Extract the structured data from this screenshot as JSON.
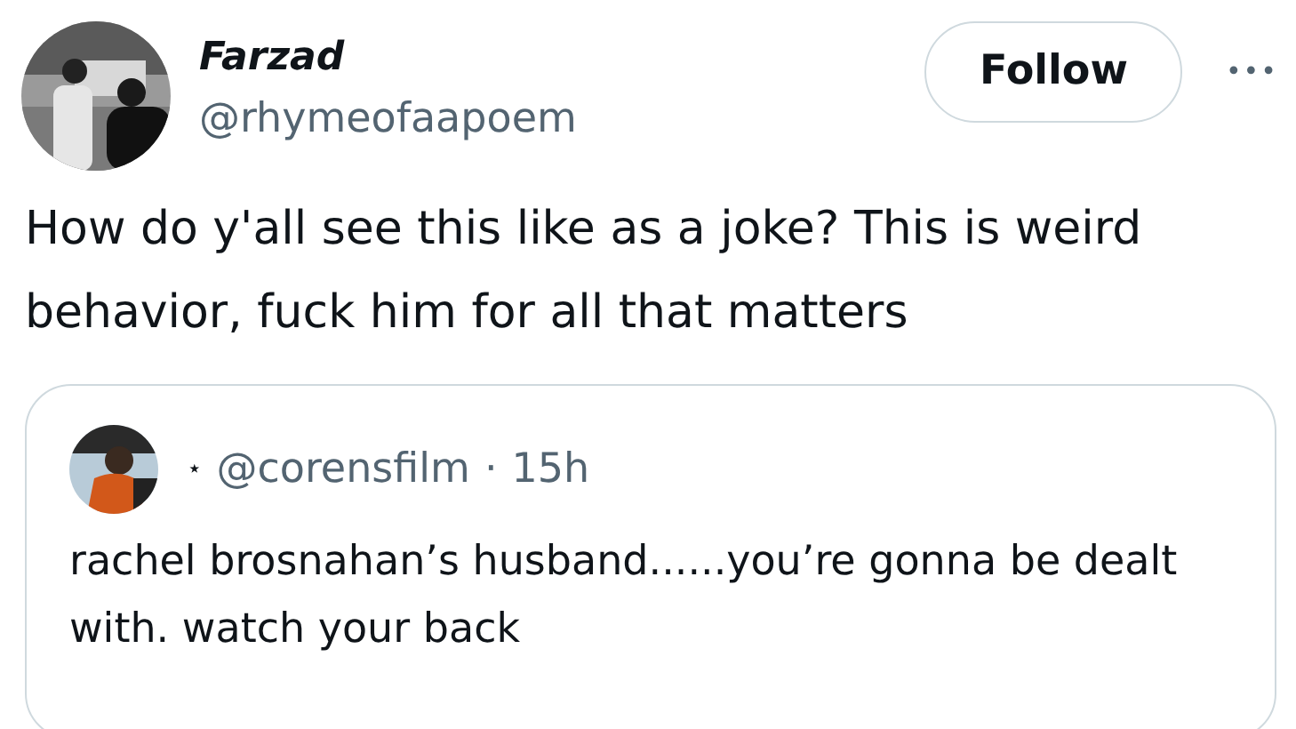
{
  "author": {
    "name": "Farzad",
    "handle": "@rhymeofaapoem"
  },
  "follow_button": {
    "label": "Follow"
  },
  "more_button": {
    "label": "•••"
  },
  "tweet_text": "How do y'all see this like as a joke? This is weird behavior, fuck him for all that matters",
  "quoted_tweet": {
    "display_name": "⋆",
    "handle": "@corensfilm",
    "separator": "·",
    "time": "15h",
    "text": "rachel brosnahan’s husband......you’re gonna be dealt with. watch your back"
  }
}
